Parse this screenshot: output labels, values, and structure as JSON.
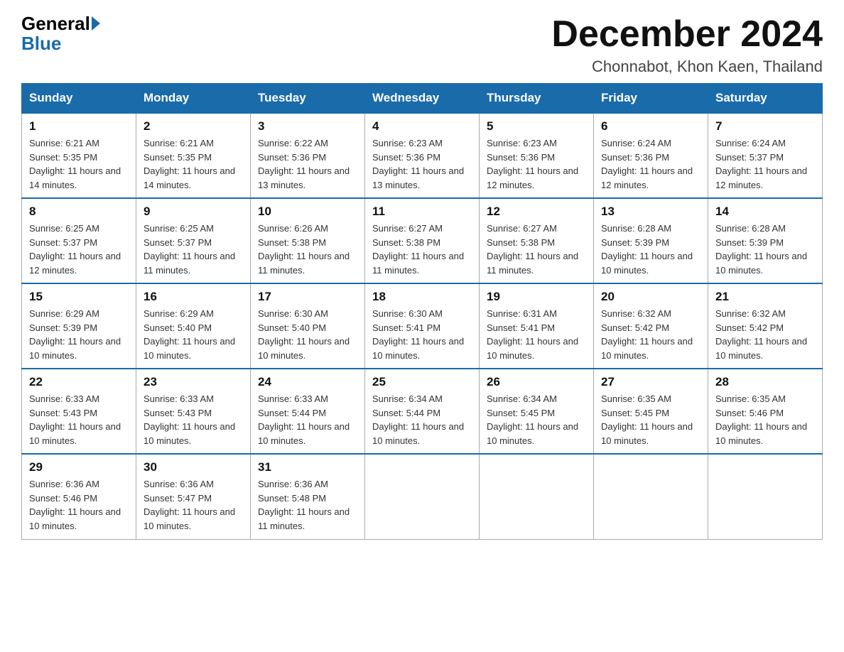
{
  "header": {
    "logo_general": "General",
    "logo_blue": "Blue",
    "month_title": "December 2024",
    "location": "Chonnabot, Khon Kaen, Thailand"
  },
  "weekdays": [
    "Sunday",
    "Monday",
    "Tuesday",
    "Wednesday",
    "Thursday",
    "Friday",
    "Saturday"
  ],
  "weeks": [
    [
      {
        "day": "1",
        "sunrise": "Sunrise: 6:21 AM",
        "sunset": "Sunset: 5:35 PM",
        "daylight": "Daylight: 11 hours and 14 minutes."
      },
      {
        "day": "2",
        "sunrise": "Sunrise: 6:21 AM",
        "sunset": "Sunset: 5:35 PM",
        "daylight": "Daylight: 11 hours and 14 minutes."
      },
      {
        "day": "3",
        "sunrise": "Sunrise: 6:22 AM",
        "sunset": "Sunset: 5:36 PM",
        "daylight": "Daylight: 11 hours and 13 minutes."
      },
      {
        "day": "4",
        "sunrise": "Sunrise: 6:23 AM",
        "sunset": "Sunset: 5:36 PM",
        "daylight": "Daylight: 11 hours and 13 minutes."
      },
      {
        "day": "5",
        "sunrise": "Sunrise: 6:23 AM",
        "sunset": "Sunset: 5:36 PM",
        "daylight": "Daylight: 11 hours and 12 minutes."
      },
      {
        "day": "6",
        "sunrise": "Sunrise: 6:24 AM",
        "sunset": "Sunset: 5:36 PM",
        "daylight": "Daylight: 11 hours and 12 minutes."
      },
      {
        "day": "7",
        "sunrise": "Sunrise: 6:24 AM",
        "sunset": "Sunset: 5:37 PM",
        "daylight": "Daylight: 11 hours and 12 minutes."
      }
    ],
    [
      {
        "day": "8",
        "sunrise": "Sunrise: 6:25 AM",
        "sunset": "Sunset: 5:37 PM",
        "daylight": "Daylight: 11 hours and 12 minutes."
      },
      {
        "day": "9",
        "sunrise": "Sunrise: 6:25 AM",
        "sunset": "Sunset: 5:37 PM",
        "daylight": "Daylight: 11 hours and 11 minutes."
      },
      {
        "day": "10",
        "sunrise": "Sunrise: 6:26 AM",
        "sunset": "Sunset: 5:38 PM",
        "daylight": "Daylight: 11 hours and 11 minutes."
      },
      {
        "day": "11",
        "sunrise": "Sunrise: 6:27 AM",
        "sunset": "Sunset: 5:38 PM",
        "daylight": "Daylight: 11 hours and 11 minutes."
      },
      {
        "day": "12",
        "sunrise": "Sunrise: 6:27 AM",
        "sunset": "Sunset: 5:38 PM",
        "daylight": "Daylight: 11 hours and 11 minutes."
      },
      {
        "day": "13",
        "sunrise": "Sunrise: 6:28 AM",
        "sunset": "Sunset: 5:39 PM",
        "daylight": "Daylight: 11 hours and 10 minutes."
      },
      {
        "day": "14",
        "sunrise": "Sunrise: 6:28 AM",
        "sunset": "Sunset: 5:39 PM",
        "daylight": "Daylight: 11 hours and 10 minutes."
      }
    ],
    [
      {
        "day": "15",
        "sunrise": "Sunrise: 6:29 AM",
        "sunset": "Sunset: 5:39 PM",
        "daylight": "Daylight: 11 hours and 10 minutes."
      },
      {
        "day": "16",
        "sunrise": "Sunrise: 6:29 AM",
        "sunset": "Sunset: 5:40 PM",
        "daylight": "Daylight: 11 hours and 10 minutes."
      },
      {
        "day": "17",
        "sunrise": "Sunrise: 6:30 AM",
        "sunset": "Sunset: 5:40 PM",
        "daylight": "Daylight: 11 hours and 10 minutes."
      },
      {
        "day": "18",
        "sunrise": "Sunrise: 6:30 AM",
        "sunset": "Sunset: 5:41 PM",
        "daylight": "Daylight: 11 hours and 10 minutes."
      },
      {
        "day": "19",
        "sunrise": "Sunrise: 6:31 AM",
        "sunset": "Sunset: 5:41 PM",
        "daylight": "Daylight: 11 hours and 10 minutes."
      },
      {
        "day": "20",
        "sunrise": "Sunrise: 6:32 AM",
        "sunset": "Sunset: 5:42 PM",
        "daylight": "Daylight: 11 hours and 10 minutes."
      },
      {
        "day": "21",
        "sunrise": "Sunrise: 6:32 AM",
        "sunset": "Sunset: 5:42 PM",
        "daylight": "Daylight: 11 hours and 10 minutes."
      }
    ],
    [
      {
        "day": "22",
        "sunrise": "Sunrise: 6:33 AM",
        "sunset": "Sunset: 5:43 PM",
        "daylight": "Daylight: 11 hours and 10 minutes."
      },
      {
        "day": "23",
        "sunrise": "Sunrise: 6:33 AM",
        "sunset": "Sunset: 5:43 PM",
        "daylight": "Daylight: 11 hours and 10 minutes."
      },
      {
        "day": "24",
        "sunrise": "Sunrise: 6:33 AM",
        "sunset": "Sunset: 5:44 PM",
        "daylight": "Daylight: 11 hours and 10 minutes."
      },
      {
        "day": "25",
        "sunrise": "Sunrise: 6:34 AM",
        "sunset": "Sunset: 5:44 PM",
        "daylight": "Daylight: 11 hours and 10 minutes."
      },
      {
        "day": "26",
        "sunrise": "Sunrise: 6:34 AM",
        "sunset": "Sunset: 5:45 PM",
        "daylight": "Daylight: 11 hours and 10 minutes."
      },
      {
        "day": "27",
        "sunrise": "Sunrise: 6:35 AM",
        "sunset": "Sunset: 5:45 PM",
        "daylight": "Daylight: 11 hours and 10 minutes."
      },
      {
        "day": "28",
        "sunrise": "Sunrise: 6:35 AM",
        "sunset": "Sunset: 5:46 PM",
        "daylight": "Daylight: 11 hours and 10 minutes."
      }
    ],
    [
      {
        "day": "29",
        "sunrise": "Sunrise: 6:36 AM",
        "sunset": "Sunset: 5:46 PM",
        "daylight": "Daylight: 11 hours and 10 minutes."
      },
      {
        "day": "30",
        "sunrise": "Sunrise: 6:36 AM",
        "sunset": "Sunset: 5:47 PM",
        "daylight": "Daylight: 11 hours and 10 minutes."
      },
      {
        "day": "31",
        "sunrise": "Sunrise: 6:36 AM",
        "sunset": "Sunset: 5:48 PM",
        "daylight": "Daylight: 11 hours and 11 minutes."
      },
      null,
      null,
      null,
      null
    ]
  ]
}
